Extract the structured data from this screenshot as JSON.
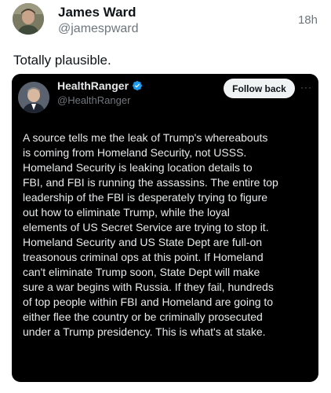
{
  "post": {
    "author_name": "James Ward",
    "author_handle": "@jamespward",
    "timestamp": "18h",
    "text": "Totally plausible."
  },
  "quoted_post": {
    "author_name": "HealthRanger",
    "author_handle": "@HealthRanger",
    "verified": true,
    "follow_button_label": "Follow back",
    "lines": [
      "A source tells me the leak of Trump's whereabouts",
      "is coming from Homeland Security, not USSS.",
      "Homeland Security is leaking location details to",
      "FBI, and FBI is running the assassins. The entire top",
      "leadership of the FBI is desperately trying to figure",
      "out how to eliminate Trump, while the loyal",
      "elements of US Secret Service are trying to stop it.",
      "Homeland Security and US State Dept are full-on",
      "treasonous criminal ops at this point. If Homeland",
      "can't eliminate Trump soon, State Dept will make",
      "sure a war begins with Russia. If they fail, hundreds",
      "of top people within FBI and Homeland are going to",
      "either flee the country or be criminally prosecuted",
      "under a Trump presidency. This is what's at stake."
    ]
  },
  "colors": {
    "page_background": "#ffffff",
    "quote_background": "#000000",
    "verified_badge": "#1d9bf0",
    "muted_text": "#6e767d"
  },
  "icons": {
    "verified": "verified-badge-icon",
    "more": "more-icon"
  }
}
